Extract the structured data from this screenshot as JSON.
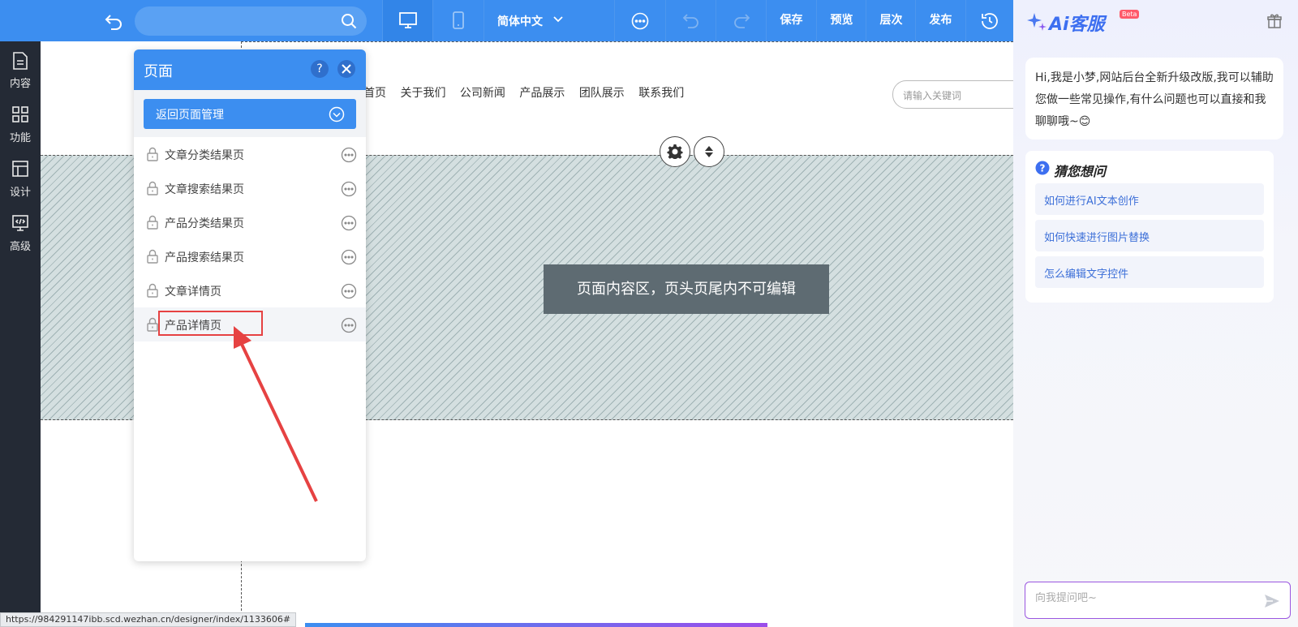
{
  "toolbar": {
    "language": "简体中文",
    "save": "保存",
    "preview": "预览",
    "layers": "层次",
    "publish": "发布"
  },
  "sidebar": {
    "items": [
      {
        "label": "内容",
        "icon": "document-icon"
      },
      {
        "label": "功能",
        "icon": "grid-icon"
      },
      {
        "label": "设计",
        "icon": "layout-icon"
      },
      {
        "label": "高级",
        "icon": "code-icon"
      }
    ]
  },
  "site": {
    "nav": [
      "首页",
      "关于我们",
      "公司新闻",
      "产品展示",
      "团队展示",
      "联系我们"
    ],
    "search_placeholder": "请输入关键词",
    "content_label": "页面内容区，页头页尾内不可编辑"
  },
  "panel": {
    "title": "页面",
    "help": "?",
    "back_button": "返回页面管理",
    "pages": [
      {
        "label": "文章分类结果页",
        "active": false
      },
      {
        "label": "文章搜索结果页",
        "active": false
      },
      {
        "label": "产品分类结果页",
        "active": false
      },
      {
        "label": "产品搜索结果页",
        "active": false
      },
      {
        "label": "文章详情页",
        "active": false
      },
      {
        "label": "产品详情页",
        "active": true
      }
    ]
  },
  "statusbar": {
    "url": "https://984291147ibb.scd.wezhan.cn/designer/index/1133606#"
  },
  "ai": {
    "title": "Ai客服",
    "beta": "Beta",
    "greeting": "Hi,我是小梦,网站后台全新升级改版,我可以辅助您做一些常见操作,有什么问题也可以直接和我聊聊哦~😊",
    "suggest_title": "猜您想问",
    "suggestions": [
      "如何进行AI文本创作",
      "如何快速进行图片替换",
      "怎么编辑文字控件"
    ],
    "input_placeholder": "向我提问吧~"
  },
  "colors": {
    "primary": "#3c8ef0",
    "sidebar": "#242a35",
    "highlight": "#e64242"
  }
}
